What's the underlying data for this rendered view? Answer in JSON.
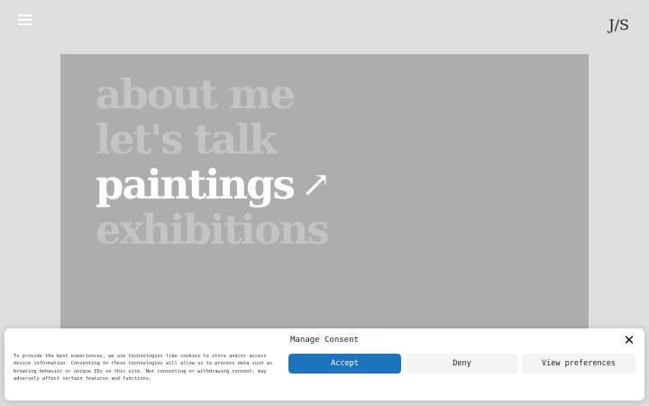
{
  "header": {
    "logo": "J/S",
    "menu_icon": "hamburger-menu-icon"
  },
  "hero": {
    "menu_items": [
      {
        "label": "about me",
        "active": false
      },
      {
        "label": "let's talk",
        "active": false
      },
      {
        "label": "paintings",
        "active": true
      },
      {
        "label": "exhibitions",
        "active": false
      }
    ],
    "active_arrow": "↗",
    "arrow_icon": "arrow-up-right-icon"
  },
  "consent": {
    "title": "Manage Consent",
    "close_icon": "close-icon",
    "close_glyph": "✕",
    "body": "To provide the best experiences, we use technologies like cookies to store and/or access device information. Consenting to these technologies will allow us to process data such as browsing behavior or unique IDs on this site. Not consenting or withdrawing consent, may adversely affect certain features and functions.",
    "buttons": {
      "accept": "Accept",
      "deny": "Deny",
      "preferences": "View preferences"
    },
    "colors": {
      "accept_bg": "#1e73be",
      "secondary_bg": "#f4f4f4"
    }
  },
  "colors": {
    "page_bg": "#dedede",
    "hero_bg": "#adadad",
    "menu_inactive": "#c4c4c4",
    "menu_active": "#ffffff"
  }
}
